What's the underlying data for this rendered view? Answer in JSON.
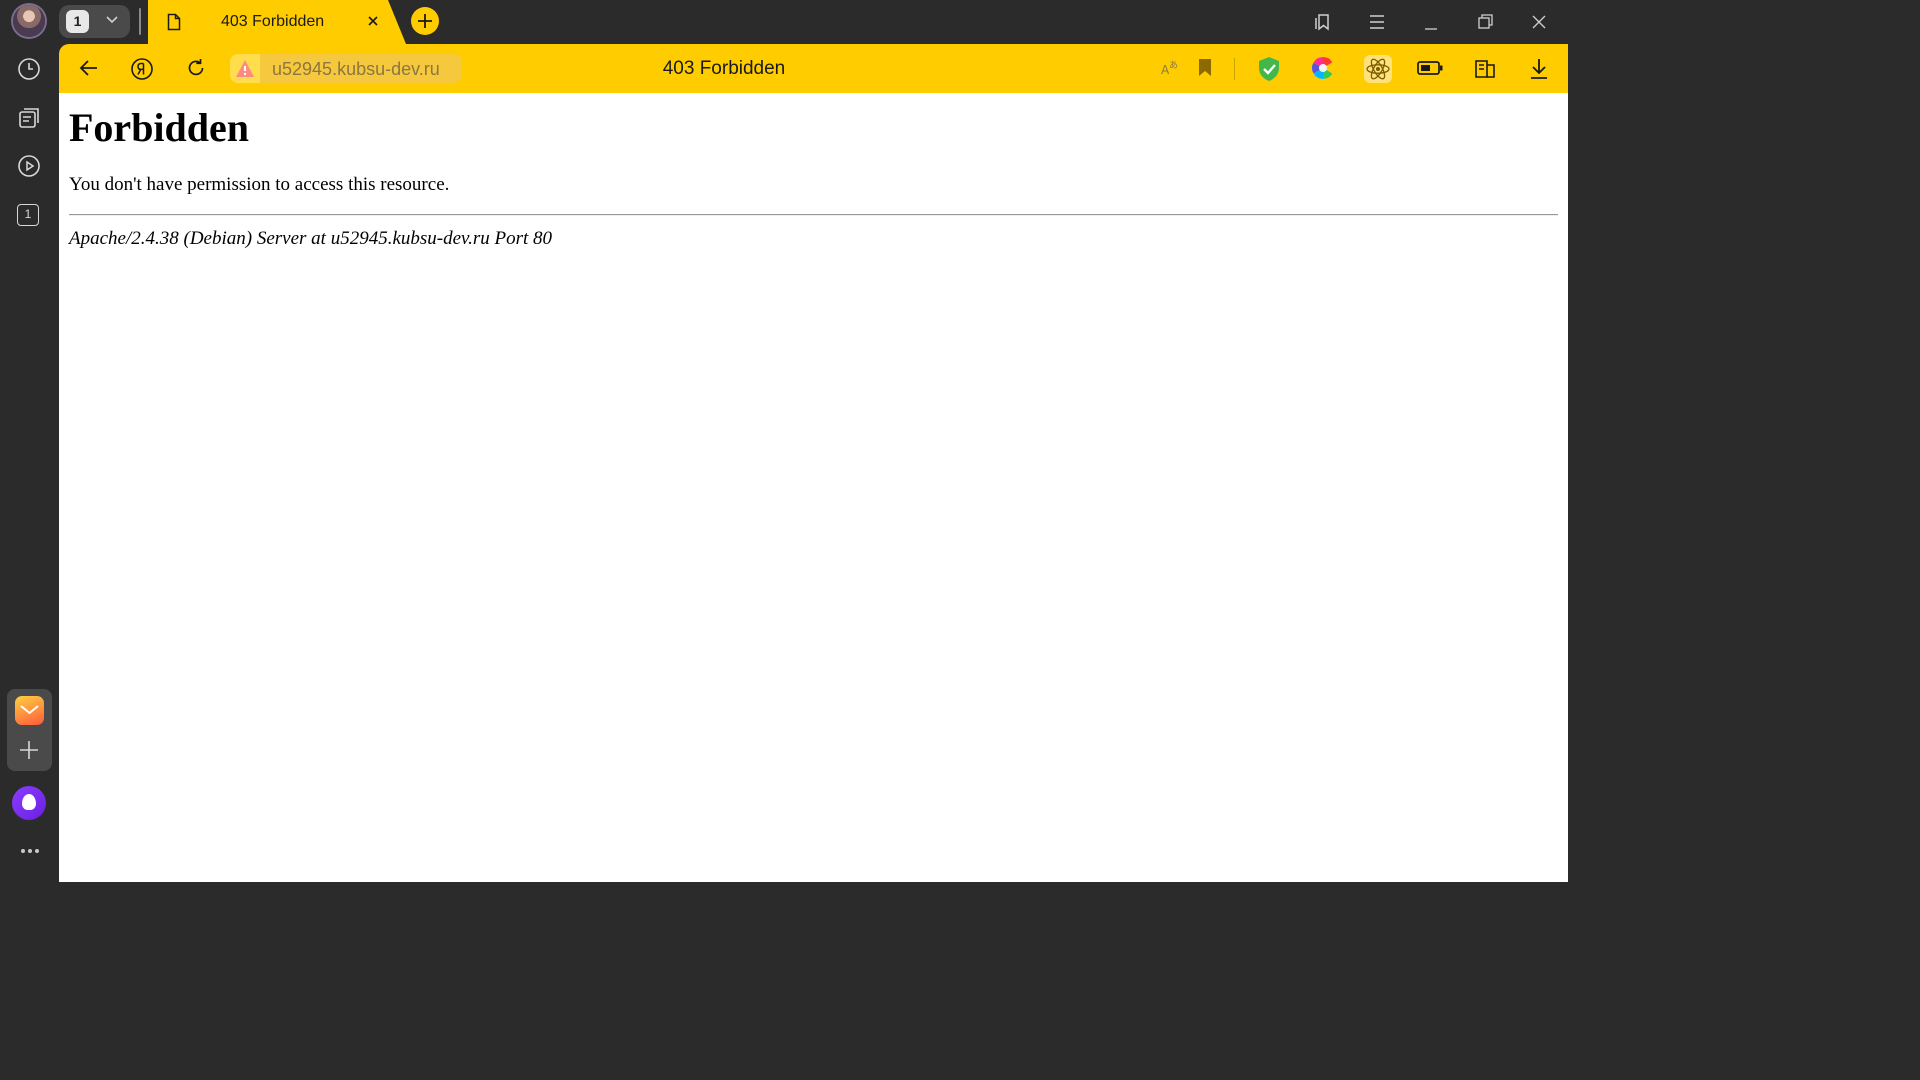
{
  "tabstrip": {
    "tab_count": "1",
    "active_tab": {
      "title": "403 Forbidden"
    }
  },
  "toolbar": {
    "url": "u52945.kubsu-dev.ru",
    "page_title": "403 Forbidden"
  },
  "page": {
    "heading": "Forbidden",
    "message": "You don't have permission to access this resource.",
    "signature": "Apache/2.4.38 (Debian) Server at u52945.kubsu-dev.ru Port 80"
  },
  "sidebar": {
    "items": [
      "history-icon",
      "collections-icon",
      "video-icon",
      "tab-counter-icon"
    ],
    "tab_count": "1"
  },
  "colors": {
    "accent": "#ffcc00",
    "chrome_bg": "#2b2b2b",
    "protect_green": "#43b84a",
    "assistant_purple": "#7a2cf0"
  }
}
